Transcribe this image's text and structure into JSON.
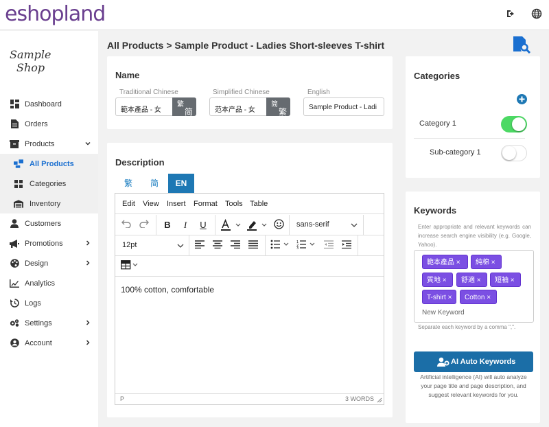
{
  "app": {
    "logo": "eshopland"
  },
  "shop": {
    "line1": "Sample",
    "line2": "Shop"
  },
  "topbar": {
    "logout_icon": "logout-icon",
    "language_icon": "globe-icon"
  },
  "sidebar": {
    "items": [
      {
        "label": "Dashboard",
        "icon": "dashboard-icon"
      },
      {
        "label": "Orders",
        "icon": "orders-icon"
      },
      {
        "label": "Products",
        "icon": "products-icon",
        "expanded": true
      },
      {
        "label": "All Products",
        "icon": "all-products-icon",
        "active": true
      },
      {
        "label": "Categories",
        "icon": "categories-icon"
      },
      {
        "label": "Inventory",
        "icon": "inventory-icon"
      },
      {
        "label": "Customers",
        "icon": "customers-icon"
      },
      {
        "label": "Promotions",
        "icon": "promotions-icon"
      },
      {
        "label": "Design",
        "icon": "design-icon"
      },
      {
        "label": "Analytics",
        "icon": "analytics-icon"
      },
      {
        "label": "Logs",
        "icon": "logs-icon"
      },
      {
        "label": "Settings",
        "icon": "settings-icon"
      },
      {
        "label": "Account",
        "icon": "account-icon"
      }
    ]
  },
  "page": {
    "breadcrumb": "All Products > Sample Product - Ladies Short-sleeves T-shirt"
  },
  "name_card": {
    "title": "Name",
    "traditional": {
      "label": "Traditional Chinese",
      "value": "範本產品 - 女",
      "convert_top": "繁",
      "convert_bottom": "简"
    },
    "simplified": {
      "label": "Simplified Chinese",
      "value": "范本产品 - 女",
      "convert_top": "简",
      "convert_bottom": "繁"
    },
    "english": {
      "label": "English",
      "value": "Sample Product - Ladi"
    }
  },
  "description_card": {
    "title": "Description",
    "tabs": [
      "繁",
      "简",
      "EN"
    ],
    "active_tab": "EN",
    "menu": [
      "Edit",
      "View",
      "Insert",
      "Format",
      "Tools",
      "Table"
    ],
    "font_family": "sans-serif",
    "font_size": "12pt",
    "content": "100% cotton, comfortable",
    "status_path": "P",
    "word_count": "3 WORDS"
  },
  "categories_card": {
    "title": "Categories",
    "items": [
      {
        "label": "Category 1",
        "on": true
      },
      {
        "label": "Sub-category 1",
        "on": false
      }
    ]
  },
  "keywords_card": {
    "title": "Keywords",
    "help": "Enter appropriate and relevant keywords can increase search engine visibility (e.g. Google, Yahoo).",
    "chips": [
      "範本產品",
      "純棉",
      "質地",
      "舒適",
      "短袖",
      "T-shirt",
      "Cotton"
    ],
    "input_placeholder": "New Keyword",
    "separator_note": "Separate each keyword by a comma \",\".",
    "ai_button": "AI Auto Keywords",
    "ai_help": "Artificial intelligence (AI) will auto analyze your page title and page description, and suggest relevant keywords for you."
  },
  "colors": {
    "accent": "#1e78b4",
    "toggle_on": "#4cd964",
    "chip": "#7b4fe3",
    "logo": "#6a3f8f"
  }
}
